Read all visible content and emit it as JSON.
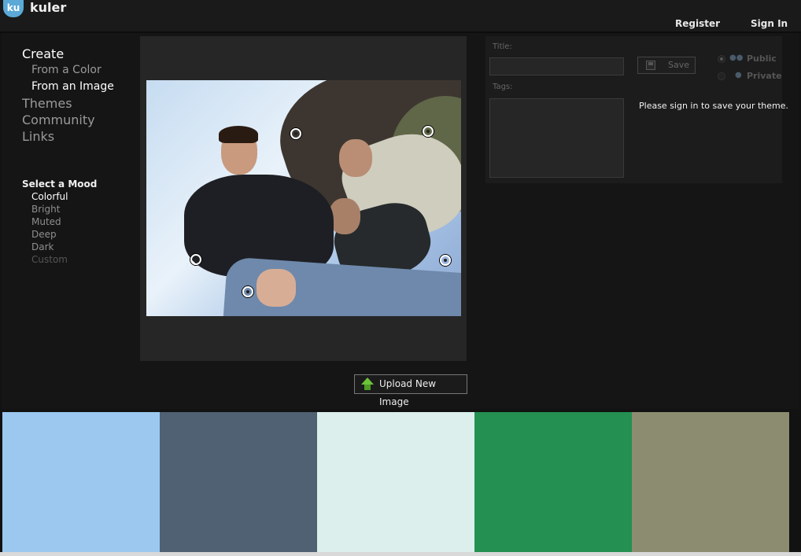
{
  "header": {
    "logo_badge": "ku",
    "logo_text": "kuler",
    "register": "Register",
    "sign_in": "Sign In"
  },
  "nav": {
    "create": "Create",
    "from_color": "From a Color",
    "from_image": "From an Image",
    "themes": "Themes",
    "community": "Community",
    "links": "Links"
  },
  "mood": {
    "title": "Select a Mood",
    "items": [
      "Colorful",
      "Bright",
      "Muted",
      "Deep",
      "Dark",
      "Custom"
    ],
    "selected": "Colorful"
  },
  "image": {
    "upload_label": "Upload New Image"
  },
  "form": {
    "title_label": "Title:",
    "title_value": "",
    "tags_label": "Tags:",
    "tags_value": "",
    "save_label": "Save",
    "public_label": "Public",
    "private_label": "Private",
    "visibility": "Public",
    "signin_message": "Please sign in to save your theme."
  },
  "swatches": [
    {
      "color": "#9cc8f0"
    },
    {
      "color": "#4f6172"
    },
    {
      "color": "#dcefec"
    },
    {
      "color": "#249052"
    },
    {
      "color": "#8c8c70"
    }
  ],
  "icons": {
    "logo": "kuler-logo-icon",
    "upload": "upload-arrow-icon",
    "save": "save-disk-icon",
    "public": "group-icon",
    "private": "person-icon"
  }
}
